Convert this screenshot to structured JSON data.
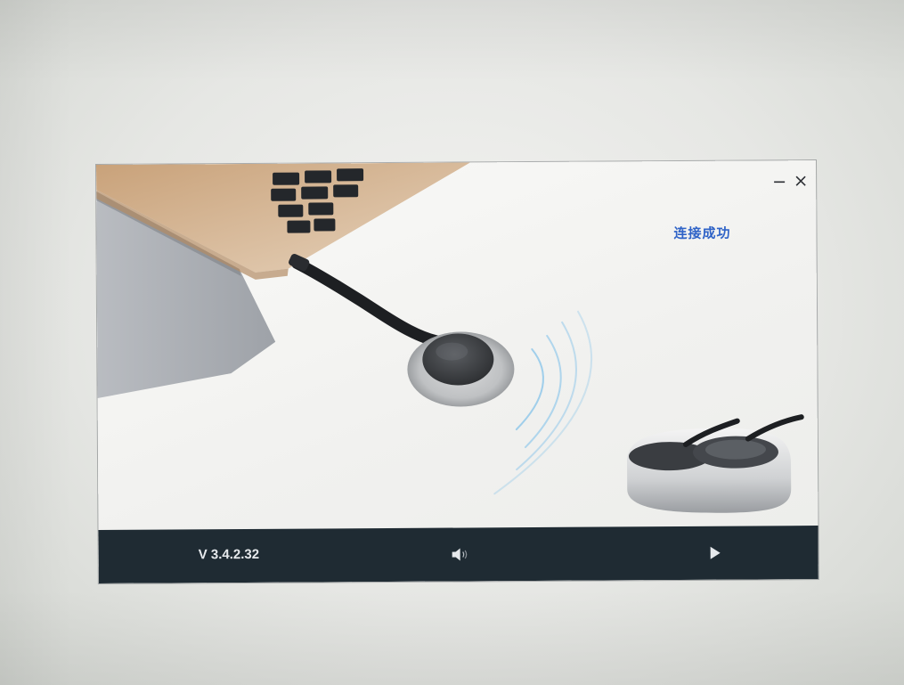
{
  "window": {
    "status": "连接成功",
    "version": "V 3.4.2.32",
    "controls": {
      "minimize_icon": "minimize-icon",
      "close_icon": "close-icon"
    }
  },
  "toolbar": {
    "speaker_icon": "speaker-icon",
    "play_icon": "play-icon"
  },
  "colors": {
    "status_text": "#2f63c7",
    "bottom_bar": "#1f2b33",
    "signal_arc": "#5fb3e8"
  }
}
